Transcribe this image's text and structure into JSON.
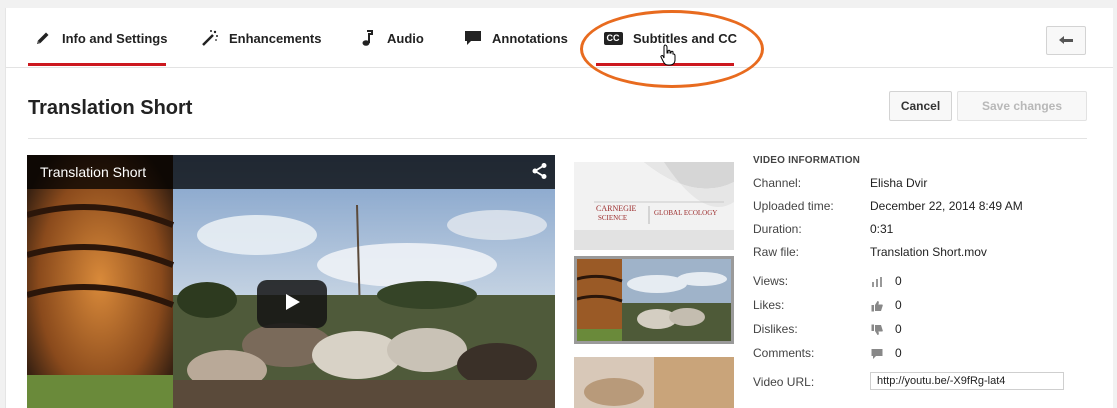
{
  "tabs": [
    {
      "label": "Info and Settings",
      "icon": "pencil-icon",
      "active": true
    },
    {
      "label": "Enhancements",
      "icon": "magic-wand-icon"
    },
    {
      "label": "Audio",
      "icon": "music-note-icon"
    },
    {
      "label": "Annotations",
      "icon": "speech-bubble-icon"
    },
    {
      "label": "Subtitles and CC",
      "icon": "cc-icon",
      "cc_badge": "CC"
    }
  ],
  "header": {
    "title": "Translation Short",
    "cancel_label": "Cancel",
    "save_label": "Save changes"
  },
  "player": {
    "title": "Translation Short"
  },
  "thumbnails": {
    "slide_line1": "CARNEGIE",
    "slide_line2": "SCIENCE",
    "slide_tag": "GLOBAL ECOLOGY"
  },
  "info": {
    "heading": "VIDEO INFORMATION",
    "channel_label": "Channel:",
    "channel": "Elisha Dvir",
    "uploaded_label": "Uploaded time:",
    "uploaded": "December 22, 2014 8:49 AM",
    "duration_label": "Duration:",
    "duration": "0:31",
    "raw_label": "Raw file:",
    "raw": "Translation Short.mov",
    "views_label": "Views:",
    "views": "0",
    "likes_label": "Likes:",
    "likes": "0",
    "dislikes_label": "Dislikes:",
    "dislikes": "0",
    "comments_label": "Comments:",
    "comments": "0",
    "url_label": "Video URL:",
    "url": "http://youtu.be/-X9fRg-lat4"
  },
  "colors": {
    "accent": "#cc181e",
    "callout": "#e86b1f"
  }
}
